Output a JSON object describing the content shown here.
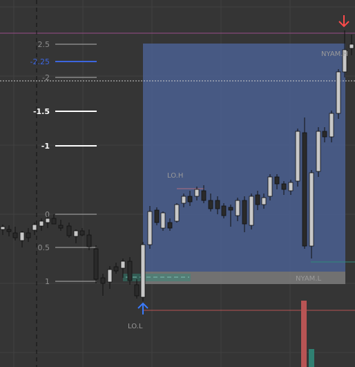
{
  "colors": {
    "background": "#353535",
    "grid": "#414141",
    "zone_fill": "#4a5f91",
    "gray_box": "#7b7b7b",
    "candle_fill": "#c8c8c8",
    "candle_dark": "#2a2a2a",
    "wick": "#111111",
    "fib_blue": "#3d66e0",
    "fib_white": "#ffffff",
    "fib_gray": "#8a8a8a",
    "up_arrow": "#3a7bff",
    "down_arrow": "#ff4b4b",
    "volume_red": "#b85454",
    "volume_teal": "#2f8072",
    "red_line": "#b85454",
    "purple_line": "#9a4d8a",
    "teal_line": "#2f8b7a",
    "dotted_line": "#cfcfcf"
  },
  "fib_levels": [
    {
      "label": "2.5",
      "style": "gray"
    },
    {
      "label": "-2.25",
      "style": "blue"
    },
    {
      "label": "-2",
      "style": "gray"
    },
    {
      "label": "-1.5",
      "style": "white"
    },
    {
      "label": "-1",
      "style": "white"
    },
    {
      "label": "0",
      "style": "gray"
    },
    {
      "label": "0.5",
      "style": "gray"
    },
    {
      "label": "1",
      "style": "gray"
    }
  ],
  "labels": {
    "lo_h": "LO.H",
    "lo_l": "LO.L",
    "nyam_h": "NYAM.H",
    "nyam_l": "NYAM.L"
  },
  "icons": {
    "up": "up-arrow-icon",
    "down": "down-arrow-icon"
  }
}
